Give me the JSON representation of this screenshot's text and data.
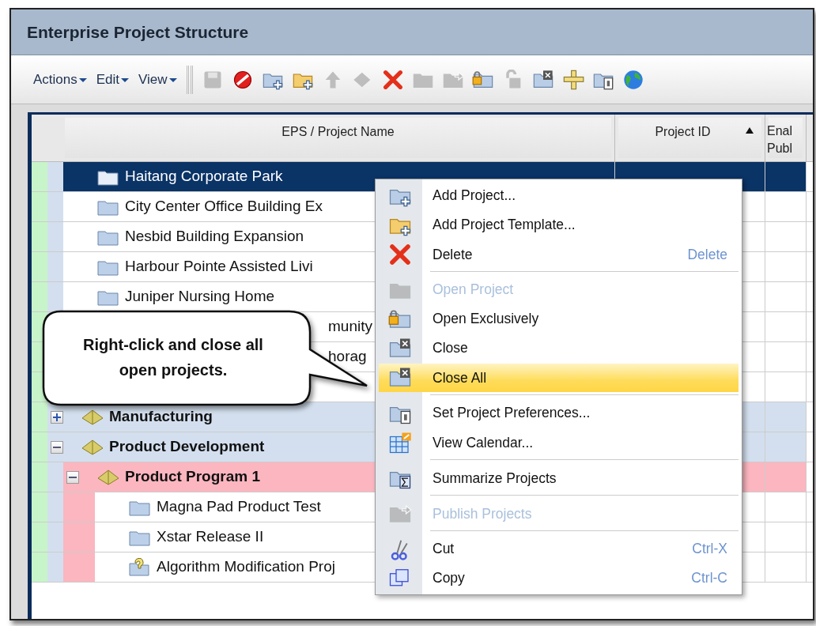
{
  "window": {
    "title": "Enterprise Project Structure"
  },
  "menus": [
    {
      "label": "Actions"
    },
    {
      "label": "Edit"
    },
    {
      "label": "View"
    }
  ],
  "toolbar": [
    {
      "kind": "save",
      "disabled": true
    },
    {
      "kind": "cancel",
      "disabled": false
    },
    {
      "kind": "add",
      "disabled": false
    },
    {
      "kind": "add-template",
      "disabled": false
    },
    {
      "kind": "move-up",
      "disabled": true
    },
    {
      "kind": "move-left",
      "disabled": true
    },
    {
      "kind": "delete",
      "disabled": false
    },
    {
      "kind": "open",
      "disabled": true
    },
    {
      "kind": "publish",
      "disabled": true
    },
    {
      "kind": "open-exclusive",
      "disabled": false
    },
    {
      "kind": "unlock",
      "disabled": true
    },
    {
      "kind": "close",
      "disabled": false
    },
    {
      "kind": "ruler",
      "disabled": false
    },
    {
      "kind": "preferences",
      "disabled": false
    },
    {
      "kind": "globe",
      "disabled": false
    }
  ],
  "table": {
    "columns": [
      {
        "label": "EPS / Project Name",
        "sorted": false
      },
      {
        "label": "Project ID",
        "sorted": true
      },
      {
        "label": "Enal Publ",
        "sorted": false
      }
    ],
    "rows": [
      {
        "kind": "project",
        "name": "Haitang Corporate Park",
        "selected": true
      },
      {
        "kind": "project",
        "name": "City Center Office Building Ex",
        "selected": false
      },
      {
        "kind": "project",
        "name": "Nesbid Building Expansion",
        "selected": false
      },
      {
        "kind": "project",
        "name": "Harbour Pointe Assisted Livi",
        "selected": false
      },
      {
        "kind": "project",
        "name": "Juniper Nursing Home",
        "selected": false
      },
      {
        "kind": "project",
        "name": "munity",
        "selected": false,
        "covered": true
      },
      {
        "kind": "project",
        "name": "horag",
        "selected": false,
        "covered": true
      },
      {
        "kind": "eps",
        "name": "Manufacturing",
        "selected": false,
        "expanded": false
      },
      {
        "kind": "eps",
        "name": "Product Development",
        "selected": false,
        "expanded": true,
        "children": [
          {
            "kind": "program",
            "name": "Product Program 1",
            "selected": false,
            "expanded": true,
            "children": [
              {
                "kind": "project",
                "name": "Magna Pad Product Test",
                "selected": false
              },
              {
                "kind": "project",
                "name": "Xstar Release II",
                "selected": false
              },
              {
                "kind": "project-what-if",
                "name": "Algorithm Modification Proj",
                "selected": false
              }
            ]
          }
        ]
      }
    ]
  },
  "context_menu": [
    {
      "kind": "add",
      "label": "Add Project...",
      "disabled": false,
      "selected": false,
      "separator_after": false
    },
    {
      "kind": "add-template",
      "label": "Add Project Template...",
      "disabled": false,
      "selected": false,
      "separator_after": false
    },
    {
      "kind": "delete",
      "label": "Delete",
      "shortcut": "Delete",
      "disabled": false,
      "selected": false,
      "separator_after": true
    },
    {
      "kind": "open",
      "label": "Open Project",
      "disabled": true,
      "selected": false,
      "separator_after": false
    },
    {
      "kind": "open-exclusive",
      "label": "Open Exclusively",
      "disabled": false,
      "selected": false,
      "separator_after": false
    },
    {
      "kind": "close",
      "label": "Close",
      "disabled": false,
      "selected": false,
      "separator_after": false
    },
    {
      "kind": "close-all",
      "label": "Close All",
      "disabled": false,
      "selected": true,
      "separator_after": true
    },
    {
      "kind": "preferences",
      "label": "Set Project Preferences...",
      "disabled": false,
      "selected": false,
      "separator_after": false
    },
    {
      "kind": "calendar",
      "label": "View Calendar...",
      "disabled": false,
      "selected": false,
      "separator_after": true
    },
    {
      "kind": "summarize",
      "label": "Summarize Projects",
      "disabled": false,
      "selected": false,
      "separator_after": true
    },
    {
      "kind": "publish",
      "label": "Publish Projects",
      "disabled": true,
      "selected": false,
      "separator_after": true
    },
    {
      "kind": "cut",
      "label": "Cut",
      "shortcut": "Ctrl-X",
      "disabled": false,
      "selected": false,
      "separator_after": false
    },
    {
      "kind": "copy",
      "label": "Copy",
      "shortcut": "Ctrl-C",
      "disabled": false,
      "selected": false,
      "separator_after": false
    }
  ],
  "callout": {
    "text": "Right-click and close all open projects."
  }
}
